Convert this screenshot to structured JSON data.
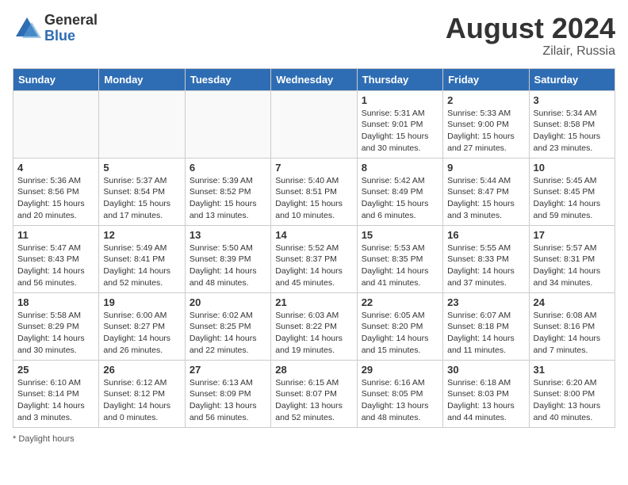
{
  "logo": {
    "general": "General",
    "blue": "Blue"
  },
  "header": {
    "month": "August 2024",
    "location": "Zilair, Russia"
  },
  "days_of_week": [
    "Sunday",
    "Monday",
    "Tuesday",
    "Wednesday",
    "Thursday",
    "Friday",
    "Saturday"
  ],
  "weeks": [
    [
      {
        "day": "",
        "info": ""
      },
      {
        "day": "",
        "info": ""
      },
      {
        "day": "",
        "info": ""
      },
      {
        "day": "",
        "info": ""
      },
      {
        "day": "1",
        "info": "Sunrise: 5:31 AM\nSunset: 9:01 PM\nDaylight: 15 hours and 30 minutes."
      },
      {
        "day": "2",
        "info": "Sunrise: 5:33 AM\nSunset: 9:00 PM\nDaylight: 15 hours and 27 minutes."
      },
      {
        "day": "3",
        "info": "Sunrise: 5:34 AM\nSunset: 8:58 PM\nDaylight: 15 hours and 23 minutes."
      }
    ],
    [
      {
        "day": "4",
        "info": "Sunrise: 5:36 AM\nSunset: 8:56 PM\nDaylight: 15 hours and 20 minutes."
      },
      {
        "day": "5",
        "info": "Sunrise: 5:37 AM\nSunset: 8:54 PM\nDaylight: 15 hours and 17 minutes."
      },
      {
        "day": "6",
        "info": "Sunrise: 5:39 AM\nSunset: 8:52 PM\nDaylight: 15 hours and 13 minutes."
      },
      {
        "day": "7",
        "info": "Sunrise: 5:40 AM\nSunset: 8:51 PM\nDaylight: 15 hours and 10 minutes."
      },
      {
        "day": "8",
        "info": "Sunrise: 5:42 AM\nSunset: 8:49 PM\nDaylight: 15 hours and 6 minutes."
      },
      {
        "day": "9",
        "info": "Sunrise: 5:44 AM\nSunset: 8:47 PM\nDaylight: 15 hours and 3 minutes."
      },
      {
        "day": "10",
        "info": "Sunrise: 5:45 AM\nSunset: 8:45 PM\nDaylight: 14 hours and 59 minutes."
      }
    ],
    [
      {
        "day": "11",
        "info": "Sunrise: 5:47 AM\nSunset: 8:43 PM\nDaylight: 14 hours and 56 minutes."
      },
      {
        "day": "12",
        "info": "Sunrise: 5:49 AM\nSunset: 8:41 PM\nDaylight: 14 hours and 52 minutes."
      },
      {
        "day": "13",
        "info": "Sunrise: 5:50 AM\nSunset: 8:39 PM\nDaylight: 14 hours and 48 minutes."
      },
      {
        "day": "14",
        "info": "Sunrise: 5:52 AM\nSunset: 8:37 PM\nDaylight: 14 hours and 45 minutes."
      },
      {
        "day": "15",
        "info": "Sunrise: 5:53 AM\nSunset: 8:35 PM\nDaylight: 14 hours and 41 minutes."
      },
      {
        "day": "16",
        "info": "Sunrise: 5:55 AM\nSunset: 8:33 PM\nDaylight: 14 hours and 37 minutes."
      },
      {
        "day": "17",
        "info": "Sunrise: 5:57 AM\nSunset: 8:31 PM\nDaylight: 14 hours and 34 minutes."
      }
    ],
    [
      {
        "day": "18",
        "info": "Sunrise: 5:58 AM\nSunset: 8:29 PM\nDaylight: 14 hours and 30 minutes."
      },
      {
        "day": "19",
        "info": "Sunrise: 6:00 AM\nSunset: 8:27 PM\nDaylight: 14 hours and 26 minutes."
      },
      {
        "day": "20",
        "info": "Sunrise: 6:02 AM\nSunset: 8:25 PM\nDaylight: 14 hours and 22 minutes."
      },
      {
        "day": "21",
        "info": "Sunrise: 6:03 AM\nSunset: 8:22 PM\nDaylight: 14 hours and 19 minutes."
      },
      {
        "day": "22",
        "info": "Sunrise: 6:05 AM\nSunset: 8:20 PM\nDaylight: 14 hours and 15 minutes."
      },
      {
        "day": "23",
        "info": "Sunrise: 6:07 AM\nSunset: 8:18 PM\nDaylight: 14 hours and 11 minutes."
      },
      {
        "day": "24",
        "info": "Sunrise: 6:08 AM\nSunset: 8:16 PM\nDaylight: 14 hours and 7 minutes."
      }
    ],
    [
      {
        "day": "25",
        "info": "Sunrise: 6:10 AM\nSunset: 8:14 PM\nDaylight: 14 hours and 3 minutes."
      },
      {
        "day": "26",
        "info": "Sunrise: 6:12 AM\nSunset: 8:12 PM\nDaylight: 14 hours and 0 minutes."
      },
      {
        "day": "27",
        "info": "Sunrise: 6:13 AM\nSunset: 8:09 PM\nDaylight: 13 hours and 56 minutes."
      },
      {
        "day": "28",
        "info": "Sunrise: 6:15 AM\nSunset: 8:07 PM\nDaylight: 13 hours and 52 minutes."
      },
      {
        "day": "29",
        "info": "Sunrise: 6:16 AM\nSunset: 8:05 PM\nDaylight: 13 hours and 48 minutes."
      },
      {
        "day": "30",
        "info": "Sunrise: 6:18 AM\nSunset: 8:03 PM\nDaylight: 13 hours and 44 minutes."
      },
      {
        "day": "31",
        "info": "Sunrise: 6:20 AM\nSunset: 8:00 PM\nDaylight: 13 hours and 40 minutes."
      }
    ]
  ],
  "footer": "Daylight hours"
}
